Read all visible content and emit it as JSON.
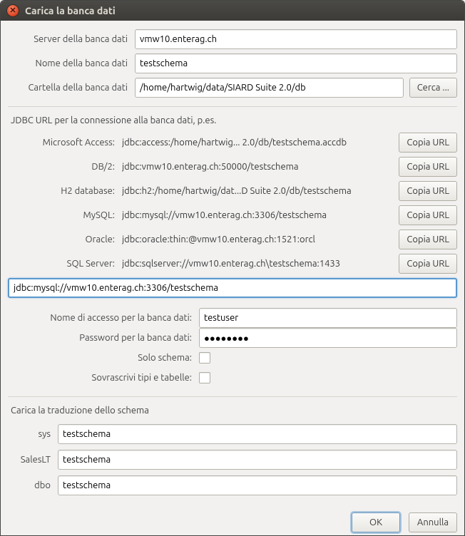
{
  "window": {
    "title": "Carica la banca dati"
  },
  "server": {
    "server_label": "Server della banca dati",
    "server_value": "vmw10.enterag.ch",
    "name_label": "Nome della banca dati",
    "name_value": "testschema",
    "folder_label": "Cartella della banca dati",
    "folder_value": "/home/hartwig/data/SIARD Suite 2.0/db",
    "browse_label": "Cerca ..."
  },
  "jdbc": {
    "section_label": "JDBC URL per la connessione alla banca dati, p.es.",
    "copy_label": "Copia URL",
    "items": [
      {
        "name": "Microsoft Access:",
        "url": "jdbc:access:/home/hartwig... 2.0/db/testschema.accdb"
      },
      {
        "name": "DB/2:",
        "url": "jdbc:vmw10.enterag.ch:50000/testschema"
      },
      {
        "name": "H2 database:",
        "url": "jdbc:h2:/home/hartwig/dat...D Suite 2.0/db/testschema"
      },
      {
        "name": "MySQL:",
        "url": "jdbc:mysql://vmw10.enterag.ch:3306/testschema"
      },
      {
        "name": "Oracle:",
        "url": "jdbc:oracle:thin:@vmw10.enterag.ch:1521:orcl"
      },
      {
        "name": "SQL Server:",
        "url": "jdbc:sqlserver://vmw10.enterag.ch\\testschema:1433"
      }
    ],
    "input_value": "jdbc:mysql://vmw10.enterag.ch:3306/testschema"
  },
  "auth": {
    "user_label": "Nome di accesso per la banca dati:",
    "user_value": "testuser",
    "password_label": "Password per la banca dati:",
    "password_value": "●●●●●●●●",
    "schema_only_label": "Solo schema:",
    "overwrite_label": "Sovrascrivi tipi e tabelle:"
  },
  "translation": {
    "section_label": "Carica la traduzione dello schema",
    "items": [
      {
        "name": "sys",
        "value": "testschema"
      },
      {
        "name": "SalesLT",
        "value": "testschema"
      },
      {
        "name": "dbo",
        "value": "testschema"
      }
    ]
  },
  "footer": {
    "ok_label": "OK",
    "cancel_label": "Annulla"
  }
}
